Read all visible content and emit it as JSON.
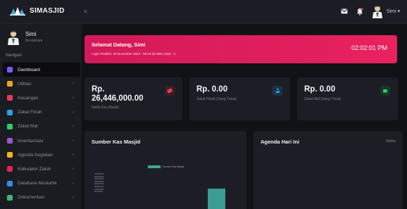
{
  "app": {
    "name": "SIMASJID"
  },
  "topbar": {
    "menu_icon": "hamburger-icon",
    "user_label": "Simi ▾",
    "icons": [
      "mail-icon",
      "bell-icon",
      "avatar"
    ]
  },
  "profile": {
    "name": "Simi",
    "role": "Bendahara"
  },
  "sidebar": {
    "heading": "Navigasi",
    "items": [
      {
        "label": "Dashboard",
        "icon": "dashboard-icon",
        "color": "#7c5cff",
        "active": true
      },
      {
        "label": "Utilitas",
        "icon": "star-icon",
        "color": "#f2a31b"
      },
      {
        "label": "Keuangan",
        "icon": "money-icon",
        "color": "#e8385a"
      },
      {
        "label": "Zakat Fitrah",
        "icon": "hand-icon",
        "color": "#2f9ee3"
      },
      {
        "label": "Zakat Mal",
        "icon": "coin-icon",
        "color": "#2ecc71"
      },
      {
        "label": "Inventarisasi",
        "icon": "box-icon",
        "color": "#9b59d0"
      },
      {
        "label": "Agenda Kegiatan",
        "icon": "calendar-icon",
        "color": "#f5b21b"
      },
      {
        "label": "Kalkulator Zakat",
        "icon": "calculator-icon",
        "color": "#e0264e"
      },
      {
        "label": "Database Mustahik",
        "icon": "database-icon",
        "color": "#2f8fe8"
      },
      {
        "label": "Dokumentasi",
        "icon": "image-icon",
        "color": "#3cb878"
      }
    ]
  },
  "welcome": {
    "title": "Selamat Datang, Simi",
    "subtitle": "Login Terakhir: 26 November 2023 - 09:34:33 WIB | Dari: ::1",
    "clock": "02:02:01 PM"
  },
  "stats": [
    {
      "value": "Rp.\n26,446,000.00",
      "label": "Saldo Kas Masjid",
      "icon": "wallet-icon",
      "color": "#e8385a"
    },
    {
      "value": "Rp. 0.00",
      "label": "Zakat Fitrah (Uang Tunai)",
      "icon": "hand-icon",
      "color": "#2f9ee3"
    },
    {
      "value": "Rp. 0.00",
      "label": "Zakat Mal (Uang Tunai)",
      "icon": "coin-icon",
      "color": "#2ecc71"
    }
  ],
  "panels": {
    "sumber_title": "Sumber Kas Masjid",
    "agenda_title": "Agenda Hari Ini",
    "agenda_right": "Waktu"
  },
  "chart_data": {
    "type": "bar",
    "title": "Sumber Kas Masjid",
    "series": [
      {
        "name": "Sumber Kas Masjid",
        "values": [
          26446000
        ]
      }
    ],
    "yticks": [
      "75000000",
      "65000000",
      "55000000",
      "45000000",
      "35000000",
      "25000000",
      "15000000",
      "5000000"
    ],
    "ylim": [
      0,
      75000000
    ],
    "legend_position": "top",
    "colors": {
      "bar": "#3a9c92"
    }
  }
}
